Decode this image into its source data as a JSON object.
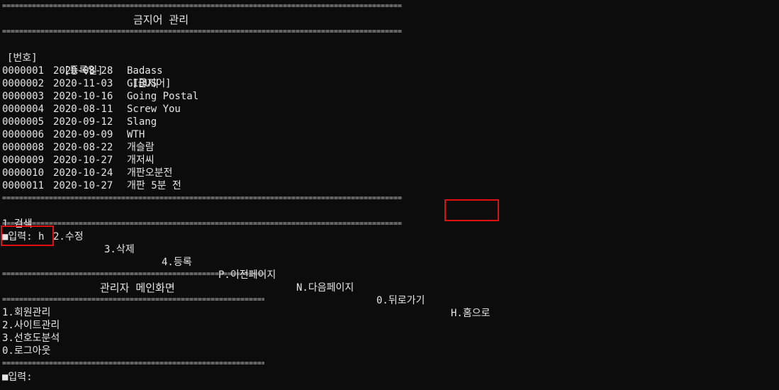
{
  "screen1": {
    "rule": "==============================================================================================",
    "title": "금지어 관리",
    "headers": [
      "[번호]",
      "[등록일]",
      "[금지어]"
    ],
    "rows": [
      {
        "no": "0000001",
        "date": "2020-08-28",
        "word": "Badass"
      },
      {
        "no": "0000002",
        "date": "2020-11-03",
        "word": "GIBUS"
      },
      {
        "no": "0000003",
        "date": "2020-10-16",
        "word": "Going Postal"
      },
      {
        "no": "0000004",
        "date": "2020-08-11",
        "word": "Screw You"
      },
      {
        "no": "0000005",
        "date": "2020-09-12",
        "word": "Slang"
      },
      {
        "no": "0000006",
        "date": "2020-09-09",
        "word": "WTH"
      },
      {
        "no": "0000008",
        "date": "2020-08-22",
        "word": "개슬람"
      },
      {
        "no": "0000009",
        "date": "2020-10-27",
        "word": "개저씨"
      },
      {
        "no": "0000010",
        "date": "2020-10-24",
        "word": "개판오분전"
      },
      {
        "no": "0000011",
        "date": "2020-10-27",
        "word": "개판 5분 전"
      }
    ],
    "menu": [
      "1.검색",
      "2.수정",
      "3.삭제",
      "4.등록",
      "P.이전페이지",
      "N.다음페이지",
      "0.뒤로가기",
      "H.홈으로"
    ],
    "prompt": "■입력: h"
  },
  "screen2": {
    "rule": "=========================================================================",
    "title": "관리자 메인화면",
    "items": [
      "1.회원관리",
      "2.사이트관리",
      "3.선호도분석",
      "0.로그아웃"
    ],
    "prompt": "■입력:"
  }
}
